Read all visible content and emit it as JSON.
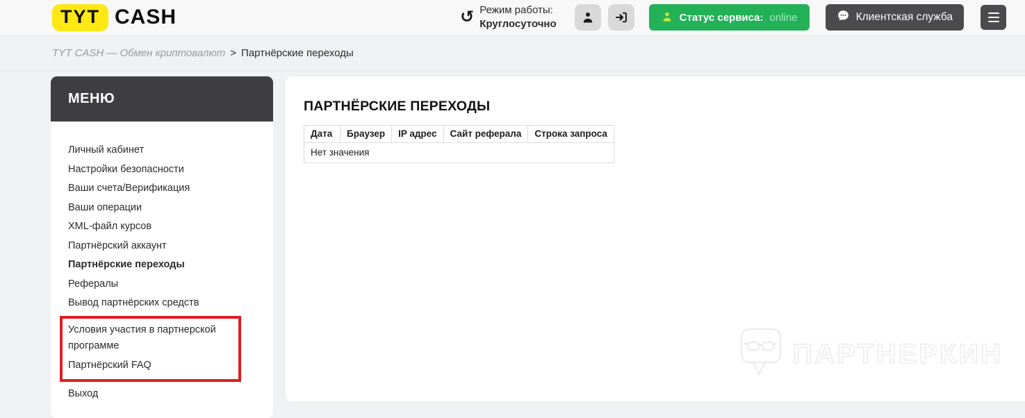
{
  "header": {
    "logo": {
      "part1": "TYT",
      "part2": "CASH"
    },
    "work_mode": {
      "label": "Режим работы:",
      "value": "Круглосуточно"
    },
    "history_glyph": "↺",
    "status_button": {
      "label": "Статус сервиса:",
      "value": "online"
    },
    "support_button": {
      "label": "Клиентская служба"
    }
  },
  "breadcrumb": {
    "root": "TYT CASH — Обмен криптовалют",
    "separator": ">",
    "current": "Партнёрские переходы"
  },
  "sidebar": {
    "title": "МЕНЮ",
    "items": [
      {
        "label": "Личный кабинет"
      },
      {
        "label": "Настройки безопасности"
      },
      {
        "label": "Ваши счета/Верификация"
      },
      {
        "label": "Ваши операции"
      },
      {
        "label": "XML-файл курсов"
      },
      {
        "label": "Партнёрский аккаунт"
      },
      {
        "label": "Партнёрские переходы",
        "active": true
      },
      {
        "label": "Рефералы"
      },
      {
        "label": "Вывод партнёрских средств"
      },
      {
        "label": "Условия участия в партнерской программе",
        "highlighted": true
      },
      {
        "label": "Партнёрский FAQ",
        "highlighted": true
      },
      {
        "label": "Выход"
      }
    ]
  },
  "main": {
    "title": "ПАРТНЁРСКИЕ ПЕРЕХОДЫ",
    "table": {
      "headers": [
        "Дата",
        "Браузер",
        "IP адрес",
        "Сайт реферала",
        "Строка запроса"
      ],
      "empty_text": "Нет значения"
    },
    "watermark": "ПАРТНЕРКИН"
  },
  "icons": {
    "history": "history-icon",
    "profile": "person-icon",
    "login": "sign-in-icon",
    "status_person": "person-icon",
    "support_chat": "chat-bubble-icon",
    "menu": "hamburger-icon",
    "watermark_bubble": "speech-bubble-glasses-icon"
  },
  "colors": {
    "brand_yellow": "#ffe814",
    "status_green": "#23b157",
    "online_text": "#a2eebb",
    "dark_button": "#4b4b4d",
    "menu_header_bg": "#3e3d40",
    "annotation_red": "#de1d22"
  }
}
